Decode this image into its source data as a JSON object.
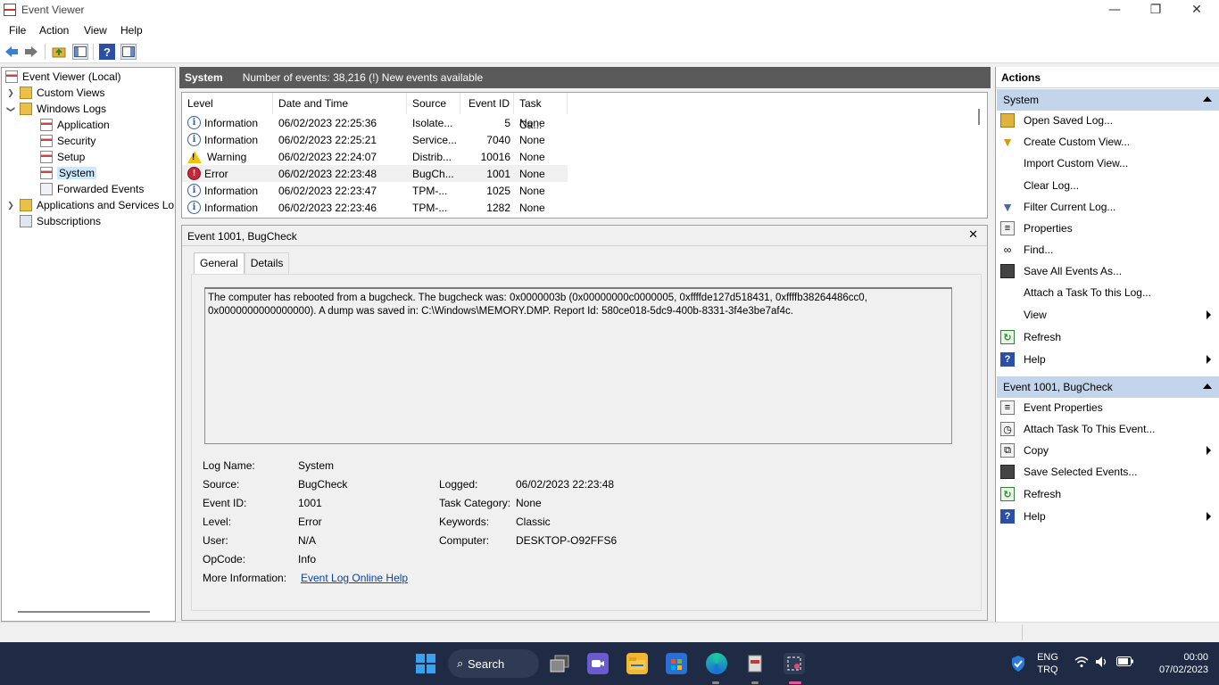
{
  "window": {
    "title": "Event Viewer",
    "controls": {
      "minimize": "—",
      "restore": "❐",
      "close": "✕"
    }
  },
  "menu": [
    "File",
    "Action",
    "View",
    "Help"
  ],
  "toolbar_icons": [
    "back-arrow-icon",
    "forward-arrow-icon",
    "folder-up-icon",
    "show-hide-tree-icon",
    "help-icon",
    "show-hide-action-pane-icon"
  ],
  "tree": {
    "root": "Event Viewer (Local)",
    "custom_views": "Custom Views",
    "windows_logs": "Windows Logs",
    "logs": [
      "Application",
      "Security",
      "Setup",
      "System",
      "Forwarded Events"
    ],
    "apps_services": "Applications and Services Lo",
    "subscriptions": "Subscriptions",
    "selected": "System"
  },
  "log_header": {
    "name": "System",
    "count": "Number of events: 38,216 (!) New events available"
  },
  "grid": {
    "columns": [
      "Level",
      "Date and Time",
      "Source",
      "Event ID",
      "Task Ca..."
    ],
    "rows": [
      {
        "level": "Information",
        "date": "06/02/2023 22:25:36",
        "source": "Isolate...",
        "id": "5",
        "task": "None"
      },
      {
        "level": "Information",
        "date": "06/02/2023 22:25:21",
        "source": "Service...",
        "id": "7040",
        "task": "None"
      },
      {
        "level": "Warning",
        "date": "06/02/2023 22:24:07",
        "source": "Distrib...",
        "id": "10016",
        "task": "None"
      },
      {
        "level": "Error",
        "date": "06/02/2023 22:23:48",
        "source": "BugCh...",
        "id": "1001",
        "task": "None"
      },
      {
        "level": "Information",
        "date": "06/02/2023 22:23:47",
        "source": "TPM-...",
        "id": "1025",
        "task": "None"
      },
      {
        "level": "Information",
        "date": "06/02/2023 22:23:46",
        "source": "TPM-...",
        "id": "1282",
        "task": "None"
      }
    ]
  },
  "detail": {
    "title": "Event 1001, BugCheck",
    "close": "✕",
    "tabs": [
      "General",
      "Details"
    ],
    "message": "The computer has rebooted from a bugcheck.  The bugcheck was: 0x0000003b (0x00000000c0000005, 0xffffde127d518431, 0xffffb38264486cc0, 0x0000000000000000). A dump was saved in: C:\\Windows\\MEMORY.DMP. Report Id: 580ce018-5dc9-400b-8331-3f4e3be7af4c.",
    "fields": {
      "log_name_label": "Log Name:",
      "log_name": "System",
      "source_label": "Source:",
      "source": "BugCheck",
      "event_id_label": "Event ID:",
      "event_id": "1001",
      "level_label": "Level:",
      "level": "Error",
      "user_label": "User:",
      "user": "N/A",
      "opcode_label": "OpCode:",
      "opcode": "Info",
      "more_info_label": "More Information:",
      "more_info_link": "Event Log Online Help",
      "logged_label": "Logged:",
      "logged": "06/02/2023 22:23:48",
      "task_category_label": "Task Category:",
      "task_category": "None",
      "keywords_label": "Keywords:",
      "keywords": "Classic",
      "computer_label": "Computer:",
      "computer": "DESKTOP-O92FFS6"
    }
  },
  "actions": {
    "title": "Actions",
    "system_section": {
      "title": "System",
      "items": [
        "Open Saved Log...",
        "Create Custom View...",
        "Import Custom View...",
        "Clear Log...",
        "Filter Current Log...",
        "Properties",
        "Find...",
        "Save All Events As...",
        "Attach a Task To this Log...",
        "View",
        "Refresh",
        "Help"
      ]
    },
    "event_section": {
      "title": "Event 1001, BugCheck",
      "items": [
        "Event Properties",
        "Attach Task To This Event...",
        "Copy",
        "Save Selected Events...",
        "Refresh",
        "Help"
      ]
    }
  },
  "taskbar": {
    "search": "Search",
    "lang_top": "ENG",
    "lang_bottom": "TRQ",
    "time": "00:00",
    "date": "07/02/2023"
  }
}
